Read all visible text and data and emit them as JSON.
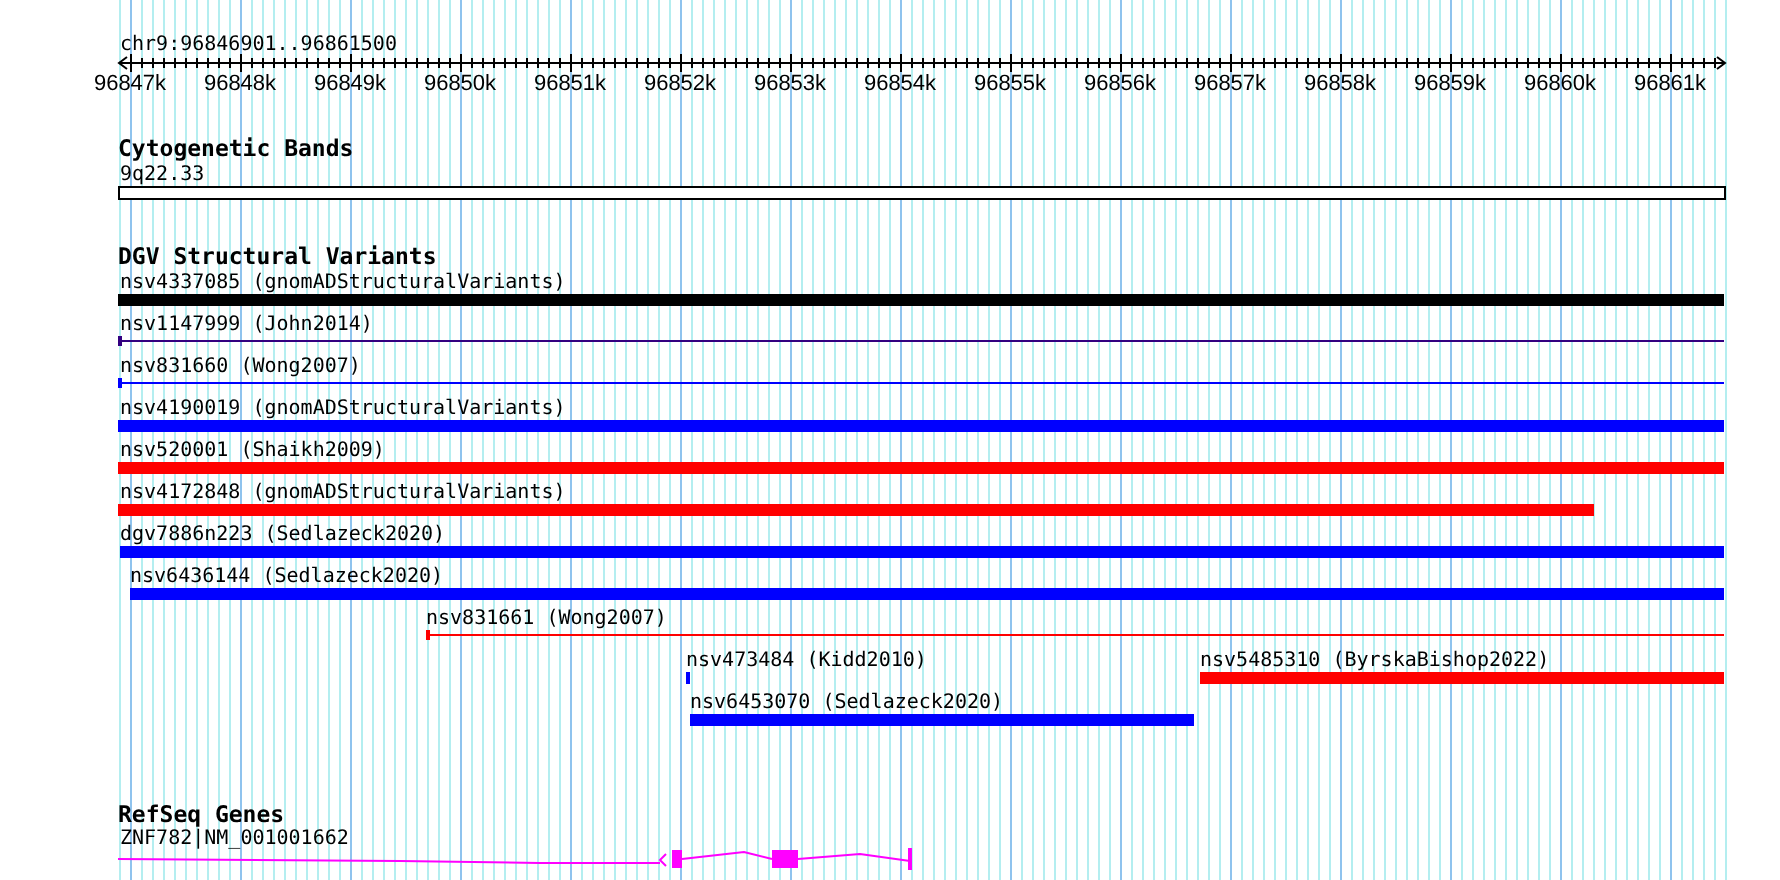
{
  "location": "chr9:96846901..96861500",
  "ruler": {
    "ticks": [
      "96847k",
      "96848k",
      "96849k",
      "96850k",
      "96851k",
      "96852k",
      "96853k",
      "96854k",
      "96855k",
      "96856k",
      "96857k",
      "96858k",
      "96859k",
      "96860k",
      "96861k"
    ]
  },
  "tracks": [
    {
      "title": "Cytogenetic Bands",
      "kind": "cytoband",
      "features": [
        {
          "label": "9q22.33",
          "kind": "band"
        }
      ]
    },
    {
      "title": "DGV Structural Variants",
      "kind": "variants",
      "features": [
        {
          "label": "nsv4337085 (gnomADStructuralVariants)",
          "kind": "bar",
          "color": "#000000"
        },
        {
          "label": "nsv1147999 (John2014)",
          "kind": "line",
          "color": "#330080"
        },
        {
          "label": "nsv831660 (Wong2007)",
          "kind": "line",
          "color": "#0000ff"
        },
        {
          "label": "nsv4190019 (gnomADStructuralVariants)",
          "kind": "bar",
          "color": "#0000ff"
        },
        {
          "label": "nsv520001 (Shaikh2009)",
          "kind": "bar",
          "color": "#ff0000"
        },
        {
          "label": "nsv4172848 (gnomADStructuralVariants)",
          "kind": "bar",
          "color": "#ff0000"
        },
        {
          "label": "dgv7886n223 (Sedlazeck2020)",
          "kind": "bar",
          "color": "#0000ff"
        },
        {
          "label": "nsv6436144 (Sedlazeck2020)",
          "kind": "bar",
          "color": "#0000ff"
        },
        {
          "label": "nsv831661 (Wong2007)",
          "kind": "line",
          "color": "#ff0000"
        },
        {
          "label": "nsv473484 (Kidd2010)",
          "kind": "bar",
          "color": "#0000ff"
        },
        {
          "label": "nsv5485310 (ByrskaBishop2022)",
          "kind": "bar",
          "color": "#ff0000"
        },
        {
          "label": "nsv6453070 (Sedlazeck2020)",
          "kind": "bar",
          "color": "#0000ff"
        }
      ]
    },
    {
      "title": "RefSeq Genes",
      "kind": "genes",
      "features": [
        {
          "label": "ZNF782|NM_001001662",
          "kind": "gene",
          "color": "#ff00ff"
        }
      ]
    }
  ]
}
